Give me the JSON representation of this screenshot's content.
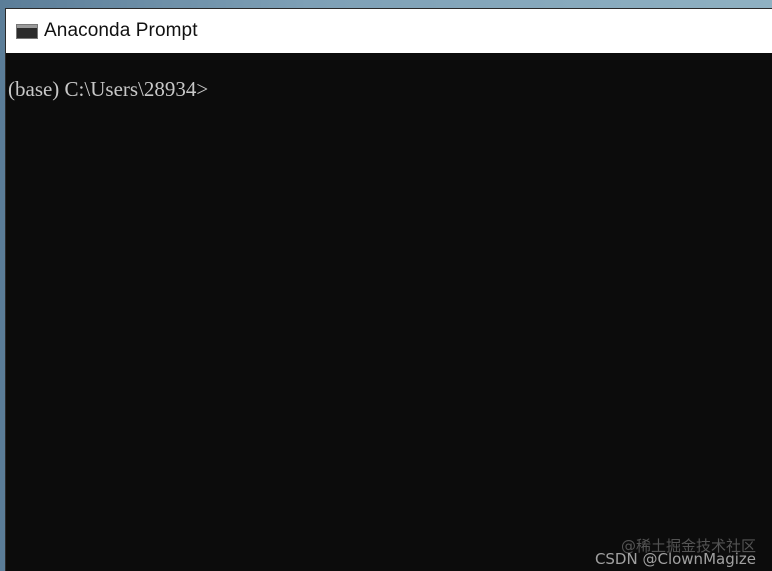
{
  "window": {
    "title": "Anaconda Prompt",
    "icon": "console-window-icon"
  },
  "console": {
    "prompt": "(base) C:\\Users\\28934>"
  },
  "watermark": {
    "line1": "@稀土掘金技术社区",
    "line2": "CSDN @ClownMagize"
  },
  "colors": {
    "console_background": "#0c0c0c",
    "console_text": "#c8c8c8",
    "titlebar_background": "#ffffff"
  }
}
